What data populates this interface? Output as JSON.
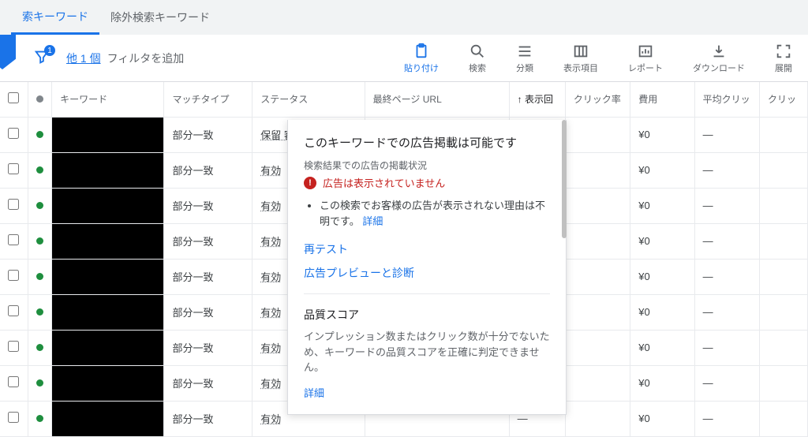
{
  "tabs": {
    "search": "索キーワード",
    "negative": "除外検索キーワード"
  },
  "filterBar": {
    "badge": "1",
    "moreLink": "他 1 個",
    "addFilter": "フィルタを追加"
  },
  "toolbar": {
    "paste": "貼り付け",
    "search": "検索",
    "segment": "分類",
    "columns": "表示項目",
    "report": "レポート",
    "download": "ダウンロード",
    "expand": "展開"
  },
  "columns": {
    "keyword": "キーワード",
    "matchType": "マッチタイプ",
    "status": "ステータス",
    "finalUrl": "最終ページ URL",
    "impressions": "表示回",
    "ctr": "クリック率",
    "cost": "費用",
    "avgCpc": "平均クリッ",
    "clicks": "クリッ",
    "sortArrow": "↑"
  },
  "rows": [
    {
      "match": "部分一致",
      "status": "保留 審査",
      "impr": "—",
      "cost": "¥0",
      "avg": "—"
    },
    {
      "match": "部分一致",
      "status": "有効",
      "impr": "—",
      "cost": "¥0",
      "avg": "—"
    },
    {
      "match": "部分一致",
      "status": "有効",
      "impr": "—",
      "cost": "¥0",
      "avg": "—"
    },
    {
      "match": "部分一致",
      "status": "有効",
      "impr": "—",
      "cost": "¥0",
      "avg": "—"
    },
    {
      "match": "部分一致",
      "status": "有効",
      "impr": "—",
      "cost": "¥0",
      "avg": "—"
    },
    {
      "match": "部分一致",
      "status": "有効",
      "impr": "—",
      "cost": "¥0",
      "avg": "—"
    },
    {
      "match": "部分一致",
      "status": "有効",
      "impr": "—",
      "cost": "¥0",
      "avg": "—"
    },
    {
      "match": "部分一致",
      "status": "有効",
      "impr": "—",
      "cost": "¥0",
      "avg": "—"
    },
    {
      "match": "部分一致",
      "status": "有効",
      "impr": "—",
      "cost": "¥0",
      "avg": "—"
    }
  ],
  "popup": {
    "title": "このキーワードでの広告掲載は可能です",
    "sub": "検索結果での広告の掲載状況",
    "warn": "広告は表示されていません",
    "bullet": "この検索でお客様の広告が表示されない理由は不明です。",
    "detailLink": "詳細",
    "retest": "再テスト",
    "preview": "広告プレビューと診断",
    "qsTitle": "品質スコア",
    "qsBody": "インプレッション数またはクリック数が十分でないため、キーワードの品質スコアを正確に判定できません。",
    "qsDetail": "詳細"
  }
}
